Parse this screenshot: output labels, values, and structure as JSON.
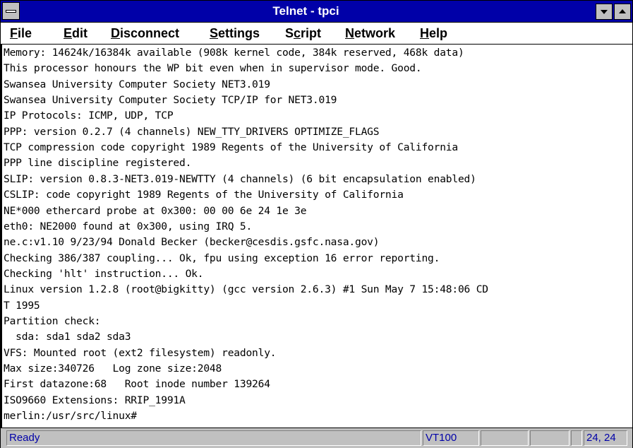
{
  "window": {
    "title": "Telnet - tpci"
  },
  "menubar": {
    "items": [
      {
        "accel": "F",
        "rest": "ile"
      },
      {
        "accel": "E",
        "rest": "dit"
      },
      {
        "accel": "D",
        "rest": "isconnect"
      },
      {
        "accel": "S",
        "rest": "ettings"
      },
      {
        "accel": "Sc",
        "pre": "",
        "rest": "ript"
      },
      {
        "accel": "N",
        "rest": "etwork"
      },
      {
        "accel": "H",
        "rest": "elp"
      }
    ]
  },
  "terminal": {
    "lines": [
      "Memory: 14624k/16384k available (908k kernel code, 384k reserved, 468k data)",
      "This processor honours the WP bit even when in supervisor mode. Good.",
      "Swansea University Computer Society NET3.019",
      "Swansea University Computer Society TCP/IP for NET3.019",
      "IP Protocols: ICMP, UDP, TCP",
      "PPP: version 0.2.7 (4 channels) NEW_TTY_DRIVERS OPTIMIZE_FLAGS",
      "TCP compression code copyright 1989 Regents of the University of California",
      "PPP line discipline registered.",
      "SLIP: version 0.8.3-NET3.019-NEWTTY (4 channels) (6 bit encapsulation enabled)",
      "CSLIP: code copyright 1989 Regents of the University of California",
      "NE*000 ethercard probe at 0x300: 00 00 6e 24 1e 3e",
      "eth0: NE2000 found at 0x300, using IRQ 5.",
      "ne.c:v1.10 9/23/94 Donald Becker (becker@cesdis.gsfc.nasa.gov)",
      "Checking 386/387 coupling... Ok, fpu using exception 16 error reporting.",
      "Checking 'hlt' instruction... Ok.",
      "Linux version 1.2.8 (root@bigkitty) (gcc version 2.6.3) #1 Sun May 7 15:48:06 CD",
      "T 1995",
      "Partition check:",
      "  sda: sda1 sda2 sda3",
      "VFS: Mounted root (ext2 filesystem) readonly.",
      "Max size:340726   Log zone size:2048",
      "First datazone:68   Root inode number 139264",
      "ISO9660 Extensions: RRIP_1991A",
      "merlin:/usr/src/linux#"
    ]
  },
  "statusbar": {
    "status": "Ready",
    "terminal_type": "VT100",
    "field3": "",
    "field4": "",
    "field5": "",
    "cursor_position": "24, 24"
  },
  "colors": {
    "titlebar": "#0000a8",
    "status_text": "#0000a8",
    "chrome": "#c0c0c0"
  }
}
